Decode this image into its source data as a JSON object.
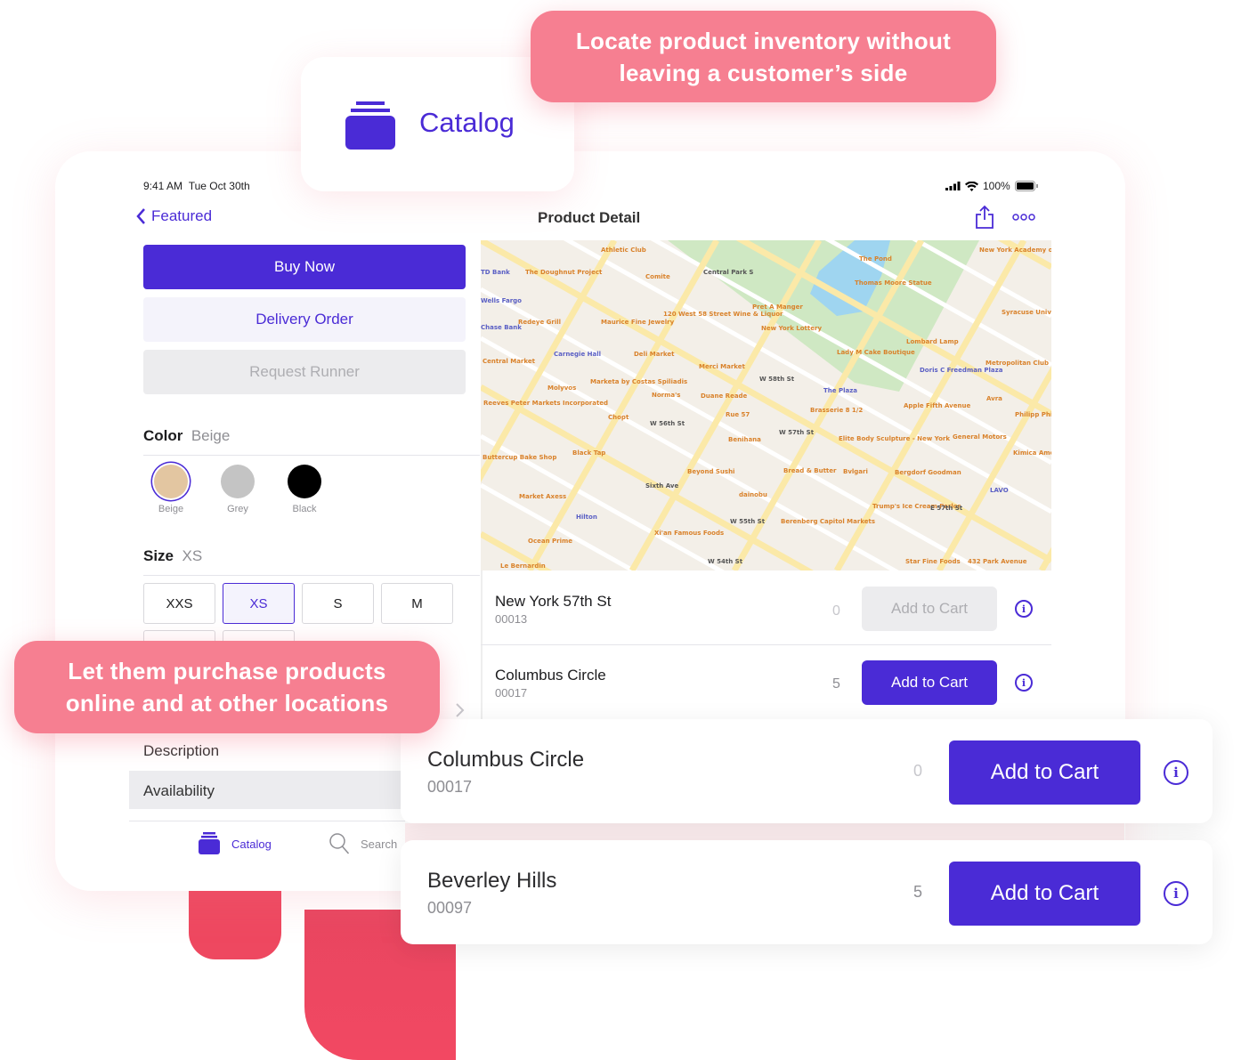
{
  "callouts": {
    "top": "Locate product inventory without leaving a customer’s side",
    "left": "Let them purchase products online and at other locations"
  },
  "catalog_badge": {
    "label": "Catalog",
    "icon": "catalog-icon"
  },
  "status_bar": {
    "time": "9:41 AM",
    "date": "Tue Oct 30th",
    "battery": "100%"
  },
  "nav": {
    "back_label": "Featured",
    "title": "Product Detail",
    "share_icon": "share-icon",
    "more_icon": "more-icon"
  },
  "actions": {
    "buy_now": "Buy Now",
    "delivery_order": "Delivery Order",
    "request_runner": "Request Runner"
  },
  "color": {
    "label": "Color",
    "selected": "Beige",
    "options": [
      {
        "name": "Beige",
        "hex": "#e3c6a1"
      },
      {
        "name": "Grey",
        "hex": "#c4c4c4"
      },
      {
        "name": "Black",
        "hex": "#000000"
      }
    ]
  },
  "size": {
    "label": "Size",
    "selected": "XS",
    "options": [
      "XXS",
      "XS",
      "S",
      "M"
    ]
  },
  "sections": {
    "description": "Description",
    "availability": "Availability"
  },
  "tab_bar": {
    "catalog": "Catalog",
    "search": "Search"
  },
  "map": {
    "labels": [
      "Athletic Club",
      "TD Bank",
      "The Doughnut Project",
      "Comite",
      "Central Park S",
      "The Pond",
      "Thomas Moore Statue",
      "New York Academy of Sciences",
      "Redeye Grill",
      "Maurice Fine Jewelry",
      "120 West 58 Street Wine & Liquor",
      "Pret A Manger",
      "New York Lottery",
      "Syracuse University Lubin House",
      "Carnegie Hall",
      "Deli Market",
      "Merci Market",
      "Lombard Lamp",
      "Lady M Cake Boutique",
      "Doris C Freedman Plaza",
      "Metropolitan Club New York",
      "Central Market",
      "Molyvos",
      "Marketa by Costas Spiliadis",
      "Norma's",
      "Duane Reade",
      "W 58th St",
      "The Plaza",
      "Avra",
      "Reeves Peter Markets Incorporated",
      "Chopt",
      "W 56th St",
      "Rue 57",
      "Brasserie 8 1/2",
      "Apple Fifth Avenue",
      "W 57th St",
      "Benihana",
      "Elite Body Sculpture - New York",
      "General Motors",
      "Black Tap",
      "Buttercup Bake Shop",
      "Beyond Sushi",
      "Bread & Butter",
      "Bvlgari",
      "Bergdorf Goodman",
      "Kimica America",
      "Sixth Ave",
      "dainobu",
      "LAVO",
      "Market Axess",
      "Hilton",
      "Trump's Ice Cream Parlor",
      "E 57th St",
      "W 55th St",
      "Berenberg Capitol Markets",
      "Ocean Prime",
      "Xi'an Famous Foods",
      "Le Bernardin",
      "W 54th St",
      "Star Fine Foods",
      "432 Park Avenue",
      "Wells Fargo",
      "Chase Bank",
      "Philipp Philipp"
    ]
  },
  "stores": [
    {
      "name": "New York 57th St",
      "code": "00013",
      "qty": "0",
      "button": "Add to Cart",
      "enabled": false
    },
    {
      "name": "Columbus Circle",
      "code": "00017",
      "qty": "5",
      "button": "Add to Cart",
      "enabled": true
    }
  ],
  "featured_stores": [
    {
      "name": "Columbus Circle",
      "code": "00017",
      "qty": "0",
      "button": "Add to Cart"
    },
    {
      "name": "Beverley Hills",
      "code": "00097",
      "qty": "5",
      "button": "Add to Cart"
    }
  ],
  "colors": {
    "accent": "#4a2bd6",
    "callout": "#f67f91",
    "red_shape": "#ee4860"
  }
}
